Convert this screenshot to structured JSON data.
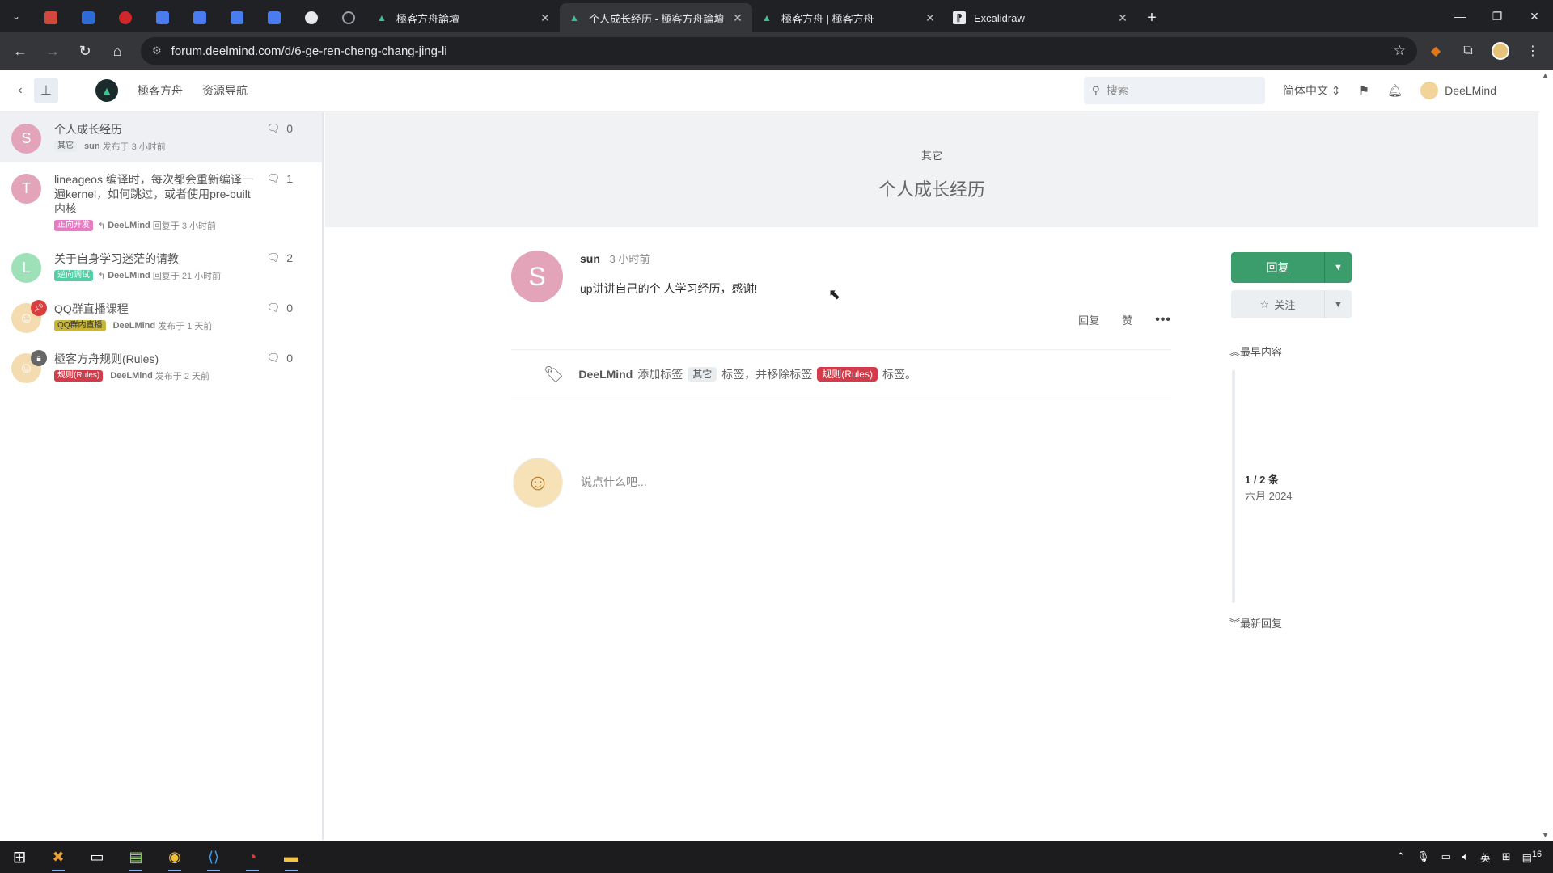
{
  "browser": {
    "tabs": [
      {
        "title": "極客方舟論壇",
        "active": false
      },
      {
        "title": "个人成长经历 - 極客方舟論壇",
        "active": true
      },
      {
        "title": "極客方舟 | 極客方舟",
        "active": false
      },
      {
        "title": "Excalidraw",
        "active": false
      }
    ],
    "url": "forum.deelmind.com/d/6-ge-ren-cheng-chang-jing-li"
  },
  "header": {
    "links": [
      "極客方舟",
      "资源导航"
    ],
    "search_placeholder": "搜索",
    "language": "简体中文",
    "username": "DeeLMind"
  },
  "discussions": [
    {
      "avatar_letter": "S",
      "avatar_color": "#e3a3b9",
      "title": "个人成长经历",
      "tags": [
        {
          "label": "其它",
          "bg": "#e9ecef",
          "fg": "#555"
        }
      ],
      "author": "sun",
      "action": "发布于 3 小时前",
      "count": "0",
      "active": true
    },
    {
      "avatar_letter": "T",
      "avatar_color": "#e3a3b9",
      "title": "lineageos 编译时，每次都会重新编译一遍kernel，如何跳过，或者使用pre-built内核",
      "tags": [
        {
          "label": "正向开发",
          "bg": "#e879c4",
          "fg": "#fff"
        }
      ],
      "author": "DeeLMind",
      "action": "回复于 3 小时前",
      "count": "1",
      "active": false
    },
    {
      "avatar_letter": "L",
      "avatar_color": "#9ee0b7",
      "title": "关于自身学习迷茫的请教",
      "tags": [
        {
          "label": "逆向调试",
          "bg": "#4fd1a5",
          "fg": "#fff"
        }
      ],
      "author": "DeeLMind",
      "action": "回复于 21 小时前",
      "count": "2",
      "active": false
    },
    {
      "avatar_letter": "",
      "avatar_color": "#f4dcb0",
      "title": "QQ群直播课程",
      "tags": [
        {
          "label": "QQ群内直播",
          "bg": "#c8b63c",
          "fg": "#333"
        }
      ],
      "author": "DeeLMind",
      "action": "发布于 1 天前",
      "count": "0",
      "active": false
    },
    {
      "avatar_letter": "",
      "avatar_color": "#f4dcb0",
      "title": "極客方舟规则(Rules)",
      "tags": [
        {
          "label": "规则(Rules)",
          "bg": "#d23c4a",
          "fg": "#fff"
        }
      ],
      "author": "DeeLMind",
      "action": "发布于 2 天前",
      "count": "0",
      "active": false
    }
  ],
  "hero": {
    "category": "其它",
    "title": "个人成长经历"
  },
  "post": {
    "avatar_letter": "S",
    "author": "sun",
    "time": "3 小时前",
    "body": "up讲讲自己的个 人学习经历，感谢!",
    "actions": {
      "reply": "回复",
      "like": "赞",
      "more": "•••"
    }
  },
  "event": {
    "user": "DeeLMind",
    "added_text": "添加标签",
    "added_tag": "其它",
    "mid_text": "标签，并移除标签",
    "removed_tag": "规则(Rules)",
    "end_text": "标签。"
  },
  "composer": {
    "placeholder": "说点什么吧..."
  },
  "sidebar_controls": {
    "reply_label": "回复",
    "follow_label": "关注",
    "earliest": "最早内容",
    "count": "1 / 2 条",
    "date": "六月 2024",
    "latest": "最新回复"
  },
  "colors": {
    "accent_green": "#3b9d6b",
    "tab_bar": "#202124",
    "hero_bg": "#f1f2f4"
  },
  "taskbar": {
    "language_indicator": "英",
    "notification_count": "16"
  }
}
